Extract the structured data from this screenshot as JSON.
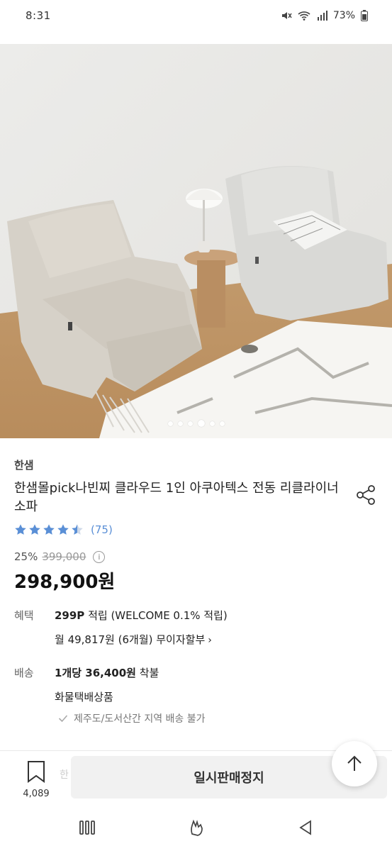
{
  "status_bar": {
    "time": "8:31",
    "battery": "73%"
  },
  "carousel": {
    "count": 6,
    "active_index": 3
  },
  "product": {
    "brand": "한샘",
    "title": "한샘몰pick나빈찌 클라우드 1인 아쿠아텍스 전동 리클라이너 소파",
    "rating": 4.5,
    "review_count": "(75)",
    "discount": "25%",
    "original_price": "399,000",
    "sale_price": "298,900원"
  },
  "benefit": {
    "label": "혜택",
    "points": "299P",
    "points_text": " 적립 (WELCOME 0.1% 적립)",
    "installment": "월 49,817원 (6개월) 무이자할부"
  },
  "shipping": {
    "label": "배송",
    "fee_bold": "1개당 36,400원",
    "fee_text": " 착불",
    "type": "화물택배상품",
    "notice": "제주도/도서산간 지역 배송 불가"
  },
  "bottom_bar": {
    "bookmark_count": "4,089",
    "hidden_text": "한",
    "sold_out_label": "일시판매정지"
  },
  "colors": {
    "accent": "#5a8fd6",
    "star": "#5a8fd6"
  }
}
